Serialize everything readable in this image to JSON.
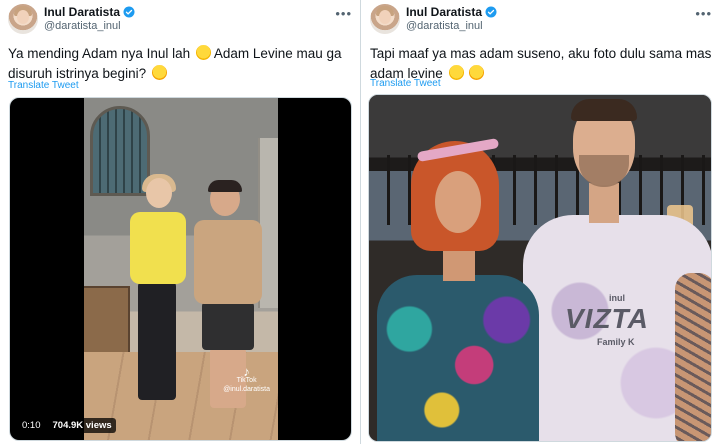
{
  "tweets": [
    {
      "author": {
        "name": "Inul Daratista",
        "handle": "@daratista_inul"
      },
      "text": "Ya mending Adam nya Inul lah",
      "text_cont": "Adam Levine mau ga disuruh istrinya begini?",
      "emoji": [
        "grinning-sweat-emoji",
        "face-with-hand-over-mouth-emoji"
      ],
      "translate_label": "Translate Tweet",
      "media": {
        "type": "video",
        "elapsed": "0:10",
        "views": "704.9K views",
        "watermark_brand": "TikTok",
        "watermark_user": "@inul.daratista"
      }
    },
    {
      "author": {
        "name": "Inul Daratista",
        "handle": "@daratista_inul"
      },
      "text": "Tapi maaf ya mas adam suseno, aku foto dulu sama mas adam levine",
      "emoji": [
        "rolling-on-floor-laughing-emoji",
        "face-with-hand-over-mouth-emoji"
      ],
      "translate_label": "Translate Tweet",
      "media": {
        "type": "photo",
        "shirt_text": {
          "top": "inul",
          "main": "VIZTA",
          "bottom": "Family K"
        }
      }
    }
  ],
  "more_icon": "more-horizontal-icon",
  "colors": {
    "link": "#1d9bf0",
    "verified": "#1d9bf0",
    "muted": "#536471"
  }
}
